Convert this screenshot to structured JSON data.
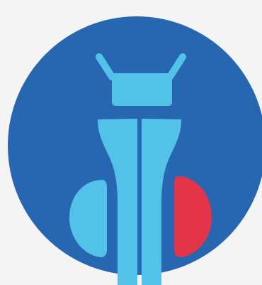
{
  "illustration": {
    "icon": "robot-bug-logo",
    "colors": {
      "background": "#f4f4f4",
      "circle": "#2767b1",
      "robot": "#53c2e9",
      "accent": "#e43447"
    }
  }
}
